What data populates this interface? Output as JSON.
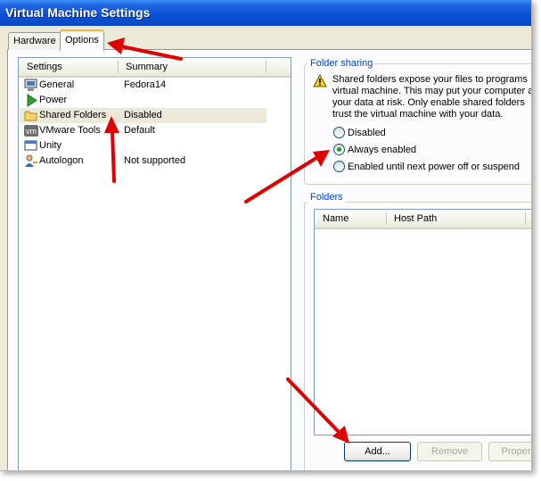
{
  "window": {
    "title": "Virtual Machine Settings"
  },
  "tabs": [
    {
      "label": "Hardware",
      "active": false
    },
    {
      "label": "Options",
      "active": true
    }
  ],
  "settings_list": {
    "columns": [
      "Settings",
      "Summary"
    ],
    "rows": [
      {
        "name": "General",
        "summary": "Fedora14",
        "icon": "general-icon"
      },
      {
        "name": "Power",
        "summary": "",
        "icon": "power-icon"
      },
      {
        "name": "Shared Folders",
        "summary": "Disabled",
        "icon": "folder-icon",
        "selected": true
      },
      {
        "name": "VMware Tools",
        "summary": "Default",
        "icon": "vmware-icon"
      },
      {
        "name": "Unity",
        "summary": "",
        "icon": "unity-icon"
      },
      {
        "name": "Autologon",
        "summary": "Not supported",
        "icon": "user-key-icon"
      }
    ]
  },
  "folder_sharing": {
    "label": "Folder sharing",
    "warning_lines": [
      "Shared folders expose your files to programs",
      "virtual machine. This may put your computer a",
      "your data at risk. Only enable shared folders",
      "trust the virtual machine with your data."
    ],
    "options": [
      {
        "label": "Disabled",
        "checked": false
      },
      {
        "label": "Always enabled",
        "checked": true
      },
      {
        "label": "Enabled until next power off or suspend",
        "checked": false
      }
    ]
  },
  "folders": {
    "label": "Folders",
    "columns": [
      "Name",
      "Host Path"
    ],
    "buttons": {
      "add": "Add...",
      "remove": "Remove",
      "properties": "Proper"
    }
  },
  "colors": {
    "annotation_arrow": "#e00000",
    "title_bar": "#0b4fd3",
    "group_label": "#0046d5"
  }
}
